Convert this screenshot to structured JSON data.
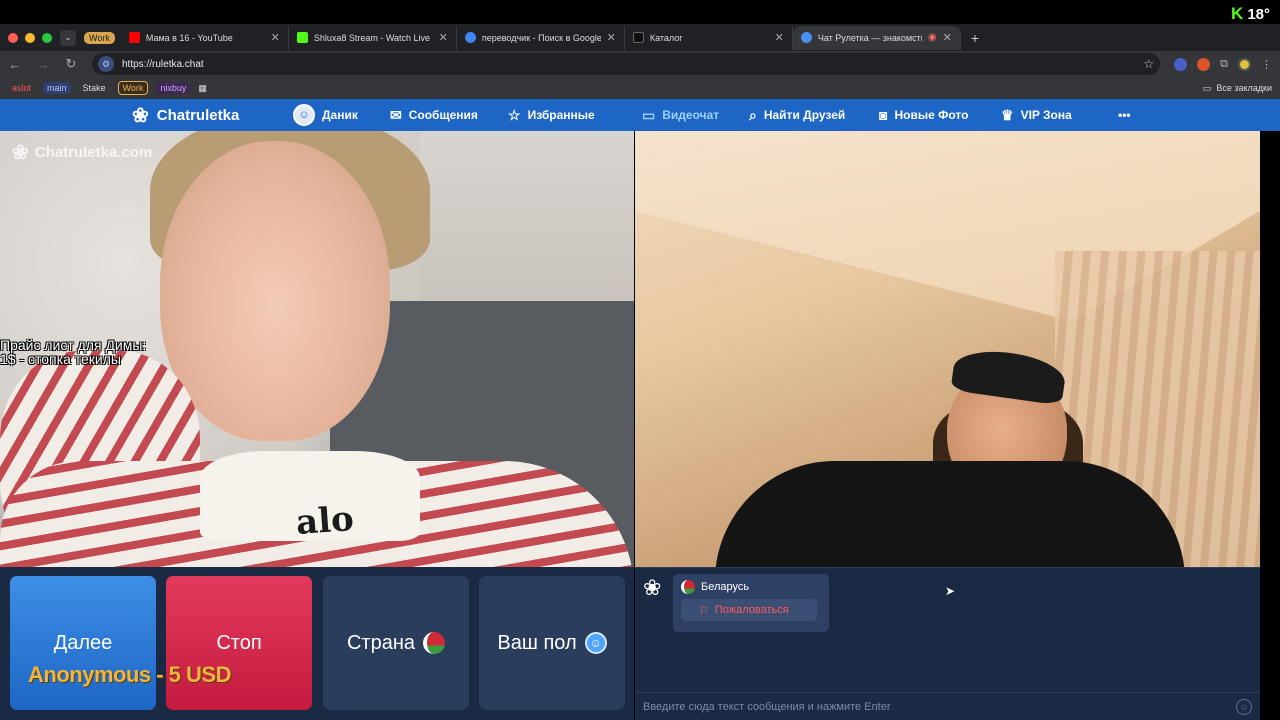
{
  "stream": {
    "logo_letter": "K",
    "temperature": "18°"
  },
  "browser": {
    "tab_group_label": "Work",
    "tabs": [
      {
        "title": "Мама в 16 - YouTube",
        "favicon_color": "#ff0000"
      },
      {
        "title": "Shluxa8 Stream - Watch Live",
        "favicon_color": "#53fc18"
      },
      {
        "title": "переводчик - Поиск в Google",
        "favicon_color": "#4285f4"
      },
      {
        "title": "Каталог",
        "favicon_color": "#111111"
      },
      {
        "title": "Чат Рулетка — знакомства",
        "favicon_color": "#4a8ff0"
      }
    ],
    "url": "https://ruletka.chat",
    "bookmarks": [
      {
        "label": "aslot",
        "bg": "#35363a",
        "color": "#ff5050"
      },
      {
        "label": "main",
        "bg": "#2d3f6e",
        "color": "#b6c8ff"
      },
      {
        "label": "Stake",
        "bg": "#35363a",
        "color": "#dddddd"
      },
      {
        "label": "Work",
        "bg": "#3a2c18",
        "color": "#e6b15c"
      },
      {
        "label": "nixbuy",
        "bg": "#3a2850",
        "color": "#d0a8ff"
      }
    ],
    "all_bookmarks": "Все закладки"
  },
  "site_nav": {
    "brand": "Chatruletka",
    "items": [
      {
        "label": "Даник",
        "icon": "user-avatar-icon"
      },
      {
        "label": "Сообщения",
        "icon": "envelope-icon"
      },
      {
        "label": "Избранные",
        "icon": "star-icon"
      },
      {
        "label": "Видеочат",
        "icon": "video-camera-icon"
      },
      {
        "label": "Найти Друзей",
        "icon": "search-icon"
      },
      {
        "label": "Новые Фото",
        "icon": "camera-icon"
      },
      {
        "label": "VIP Зона",
        "icon": "crown-icon"
      }
    ],
    "more": "•••"
  },
  "left_video": {
    "watermark": "Chatruletka.com",
    "overlay_line1": "Прайс лист для Димы:",
    "overlay_line2": "1$ - стопка текилы",
    "shirt_logo": "alo"
  },
  "controls": {
    "next_label": "Далее",
    "stop_label": "Стоп",
    "country_label": "Страна",
    "gender_label": "Ваш пол",
    "donation": "Anonymous - 5 USD"
  },
  "chat": {
    "country": "Беларусь",
    "report_label": "Пожаловаться",
    "input_placeholder": "Введите сюда текст сообщения и нажмите Enter"
  }
}
